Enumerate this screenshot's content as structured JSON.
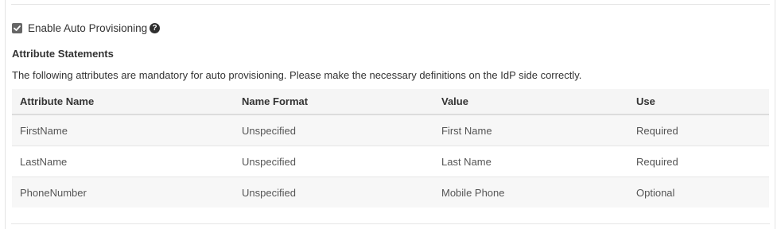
{
  "auto_provisioning": {
    "checkbox_label": "Enable Auto Provisioning",
    "checked": true,
    "help_icon": "question-circle-icon"
  },
  "attribute_statements": {
    "title": "Attribute Statements",
    "description": "The following attributes are mandatory for auto provisioning. Please make the necessary definitions on the IdP side correctly.",
    "columns": [
      "Attribute Name",
      "Name Format",
      "Value",
      "Use"
    ],
    "rows": [
      {
        "attribute_name": "FirstName",
        "name_format": "Unspecified",
        "value": "First Name",
        "use": "Required"
      },
      {
        "attribute_name": "LastName",
        "name_format": "Unspecified",
        "value": "Last Name",
        "use": "Required"
      },
      {
        "attribute_name": "PhoneNumber",
        "name_format": "Unspecified",
        "value": "Mobile Phone",
        "use": "Optional"
      }
    ]
  }
}
